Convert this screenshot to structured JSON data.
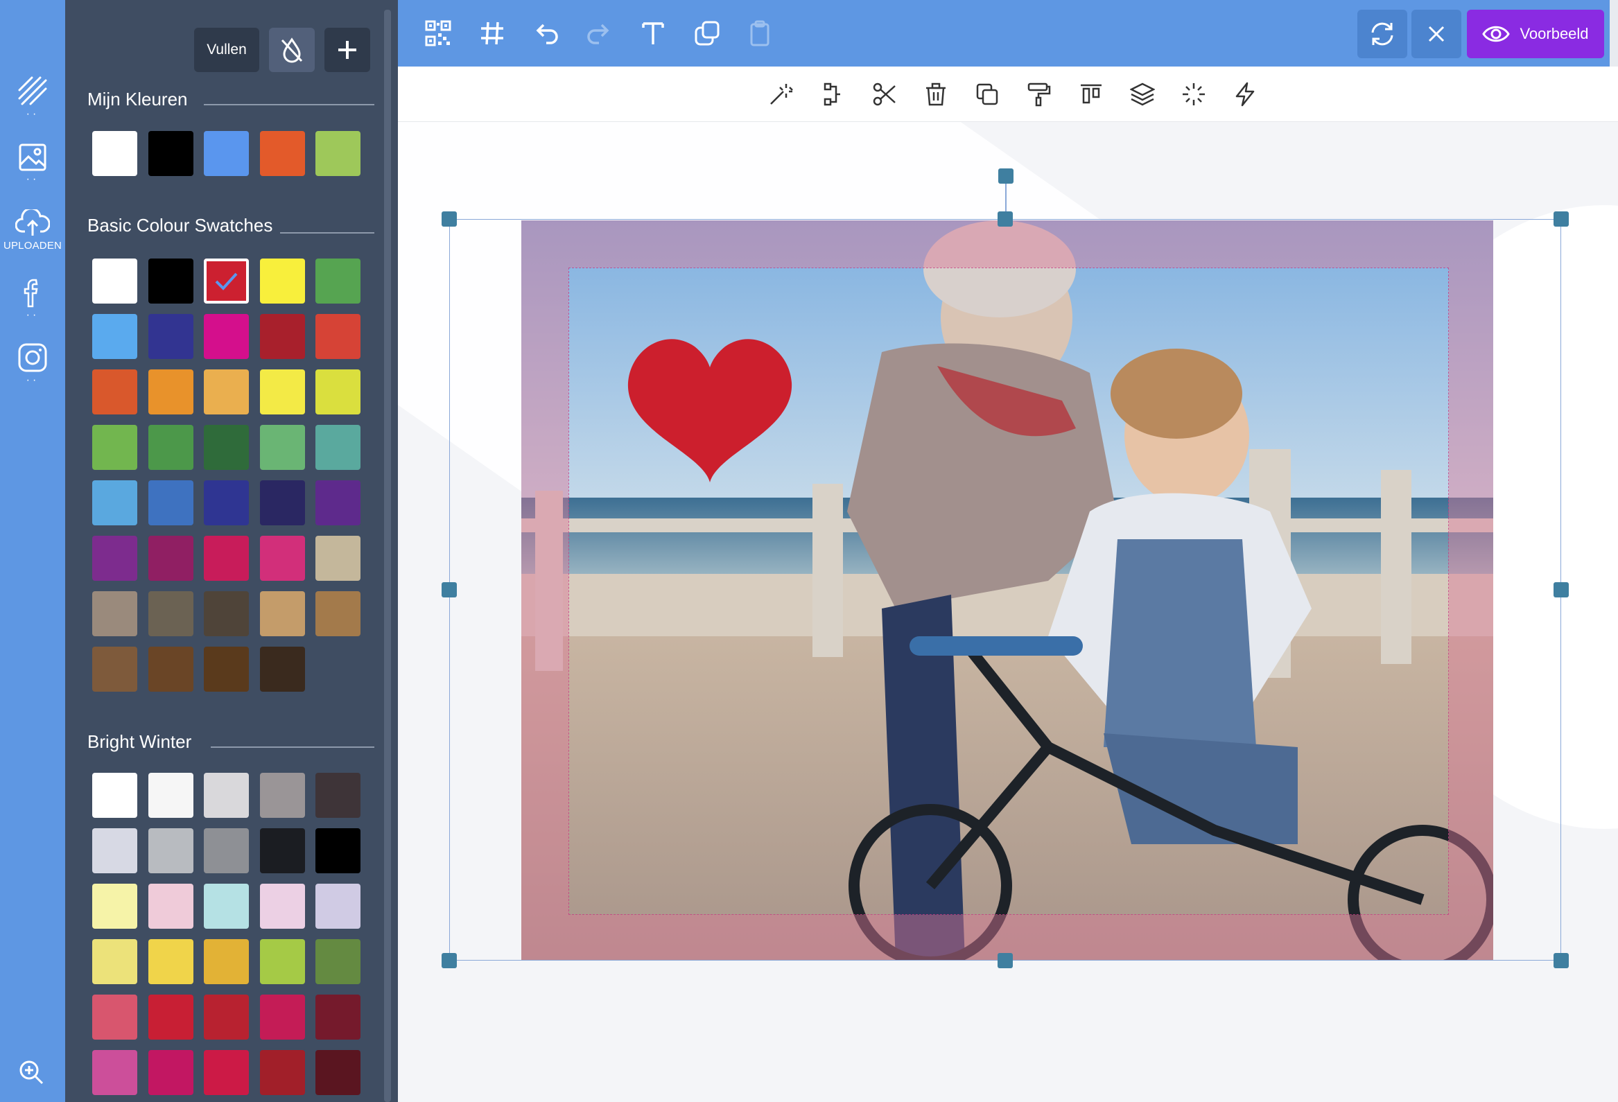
{
  "rail": {
    "items": [
      {
        "name": "patterns",
        "icon": "diagonal-lines-icon"
      },
      {
        "name": "images",
        "icon": "image-icon"
      },
      {
        "name": "upload",
        "icon": "cloud-upload-icon",
        "label": "UPLOADEN"
      },
      {
        "name": "facebook",
        "icon": "facebook-icon"
      },
      {
        "name": "instagram",
        "icon": "instagram-icon"
      }
    ],
    "zoom_icon": "zoom-in-icon"
  },
  "panel": {
    "fill_label": "Vullen",
    "no_fill_icon": "no-fill-drop-icon",
    "add_icon": "plus-icon",
    "sections": [
      {
        "title": "Mijn Kleuren",
        "swatches": [
          "#ffffff",
          "#000000",
          "#5a96ee",
          "#e35a2a",
          "#9ec85a"
        ]
      },
      {
        "title": "Basic Colour Swatches",
        "selected_index": 2,
        "swatches": [
          "#ffffff",
          "#000000",
          "#cc2030",
          "#f8ef3c",
          "#56a451",
          "#5aaaee",
          "#323491",
          "#d40f8c",
          "#a8202c",
          "#d64336",
          "#d9582c",
          "#e8922b",
          "#eaaf4f",
          "#f3ea46",
          "#dadf3e",
          "#72b64f",
          "#4c984a",
          "#2f6b3a",
          "#6ab574",
          "#5aa99e",
          "#5aa8df",
          "#3e72c0",
          "#2f3592",
          "#2a2762",
          "#5e2a8c",
          "#7d2c8e",
          "#901f63",
          "#c81c5a",
          "#d22f7a",
          "#c4b79b",
          "#9a8a7c",
          "#6b6253",
          "#4f4439",
          "#c49c6a",
          "#a37a4b",
          "#7e5a3b",
          "#6a4526",
          "#5a3a1c",
          "#3a2a1e"
        ]
      },
      {
        "title": "Bright Winter",
        "swatches": [
          "#ffffff",
          "#f6f6f6",
          "#d9d8db",
          "#9a9597",
          "#3e3438",
          "#d7d9e4",
          "#b8bbc0",
          "#8e9095",
          "#1b1d22",
          "#000000",
          "#f6f3a8",
          "#efcbd9",
          "#b5e1e4",
          "#ecd0e4",
          "#d0cbe4",
          "#ece27a",
          "#f0d44a",
          "#e2b236",
          "#a5ca46",
          "#648a41",
          "#d8566e",
          "#c81f34",
          "#b82230",
          "#c41c56",
          "#751a2c",
          "#cc4f9a",
          "#c21762",
          "#cc1a46",
          "#a11f29",
          "#5a1520"
        ]
      }
    ]
  },
  "topbar": {
    "left_icons": [
      "qr-code-icon",
      "grid-hash-icon",
      "undo-icon",
      "redo-icon",
      "text-icon",
      "copy-layers-icon",
      "clipboard-icon"
    ],
    "refresh_icon": "refresh-icon",
    "close_icon": "close-icon",
    "preview_label": "Voorbeeld",
    "preview_icon": "eye-icon"
  },
  "toolbar2": {
    "icons": [
      "magic-wand-icon",
      "crop-icon",
      "scissors-icon",
      "trash-icon",
      "duplicate-icon",
      "paint-roller-icon",
      "align-top-icon",
      "layers-icon",
      "sparkle-icon",
      "lightning-icon"
    ]
  },
  "canvas": {
    "photo_description_icon": "photo-icon",
    "sticker": "heart-icon",
    "colors": {
      "heart": "#cc1f2d",
      "bleed": "#e8869c",
      "handle": "#3f7fa0"
    }
  }
}
